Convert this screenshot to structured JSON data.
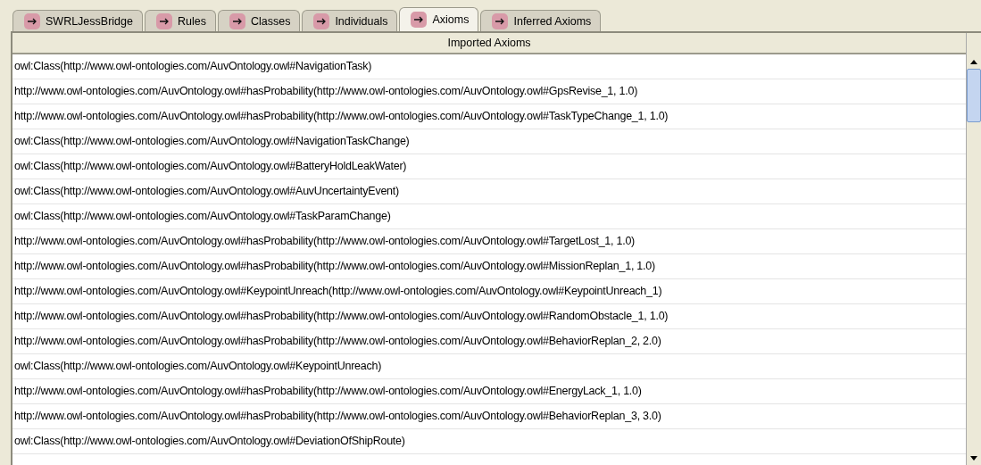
{
  "tabs": [
    {
      "label": "SWRLJessBridge",
      "selected": false
    },
    {
      "label": "Rules",
      "selected": false
    },
    {
      "label": "Classes",
      "selected": false
    },
    {
      "label": "Individuals",
      "selected": false
    },
    {
      "label": "Axioms",
      "selected": true
    },
    {
      "label": "Inferred Axioms",
      "selected": false
    }
  ],
  "table": {
    "columns": [
      "Imported Axioms"
    ],
    "rows": [
      "owl:Class(http://www.owl-ontologies.com/AuvOntology.owl#NavigationTask)",
      "http://www.owl-ontologies.com/AuvOntology.owl#hasProbability(http://www.owl-ontologies.com/AuvOntology.owl#GpsRevise_1, 1.0)",
      "http://www.owl-ontologies.com/AuvOntology.owl#hasProbability(http://www.owl-ontologies.com/AuvOntology.owl#TaskTypeChange_1, 1.0)",
      "owl:Class(http://www.owl-ontologies.com/AuvOntology.owl#NavigationTaskChange)",
      "owl:Class(http://www.owl-ontologies.com/AuvOntology.owl#BatteryHoldLeakWater)",
      "owl:Class(http://www.owl-ontologies.com/AuvOntology.owl#AuvUncertaintyEvent)",
      "owl:Class(http://www.owl-ontologies.com/AuvOntology.owl#TaskParamChange)",
      "http://www.owl-ontologies.com/AuvOntology.owl#hasProbability(http://www.owl-ontologies.com/AuvOntology.owl#TargetLost_1, 1.0)",
      "http://www.owl-ontologies.com/AuvOntology.owl#hasProbability(http://www.owl-ontologies.com/AuvOntology.owl#MissionReplan_1, 1.0)",
      "http://www.owl-ontologies.com/AuvOntology.owl#KeypointUnreach(http://www.owl-ontologies.com/AuvOntology.owl#KeypointUnreach_1)",
      "http://www.owl-ontologies.com/AuvOntology.owl#hasProbability(http://www.owl-ontologies.com/AuvOntology.owl#RandomObstacle_1, 1.0)",
      "http://www.owl-ontologies.com/AuvOntology.owl#hasProbability(http://www.owl-ontologies.com/AuvOntology.owl#BehaviorReplan_2, 2.0)",
      "owl:Class(http://www.owl-ontologies.com/AuvOntology.owl#KeypointUnreach)",
      "http://www.owl-ontologies.com/AuvOntology.owl#hasProbability(http://www.owl-ontologies.com/AuvOntology.owl#EnergyLack_1, 1.0)",
      "http://www.owl-ontologies.com/AuvOntology.owl#hasProbability(http://www.owl-ontologies.com/AuvOntology.owl#BehaviorReplan_3, 3.0)",
      "owl:Class(http://www.owl-ontologies.com/AuvOntology.owl#DeviationOfShipRoute)"
    ]
  }
}
